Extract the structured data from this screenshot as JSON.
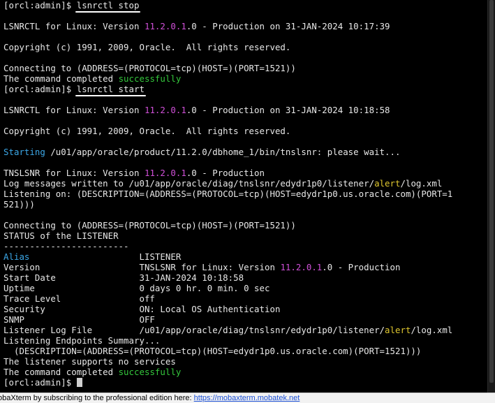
{
  "colors": {
    "text": "#e8e8e8",
    "version": "#d050d8",
    "success": "#34c83c",
    "cyan": "#3ca8e8",
    "alert": "#e0c830"
  },
  "terminal_lines": [
    [
      {
        "t": "[orcl:admin]$ "
      },
      {
        "t": "lsnrctl stop",
        "u": true
      }
    ],
    [],
    [
      {
        "t": "LSNRCTL for Linux: Version "
      },
      {
        "t": "11.2.0.1",
        "c": "version"
      },
      {
        "t": ".0 - Production on 31-JAN-2024 10:17:39"
      }
    ],
    [],
    [
      {
        "t": "Copyright (c) 1991, 2009, Oracle.  All rights reserved."
      }
    ],
    [],
    [
      {
        "t": "Connecting to (ADDRESS=(PROTOCOL=tcp)(HOST=)(PORT=1521))"
      }
    ],
    [
      {
        "t": "The command completed "
      },
      {
        "t": "successfully",
        "c": "success"
      }
    ],
    [
      {
        "t": "[orcl:admin]$ "
      },
      {
        "t": "lsnrctl start",
        "u": true
      }
    ],
    [],
    [
      {
        "t": "LSNRCTL for Linux: Version "
      },
      {
        "t": "11.2.0.1",
        "c": "version"
      },
      {
        "t": ".0 - Production on 31-JAN-2024 10:18:58"
      }
    ],
    [],
    [
      {
        "t": "Copyright (c) 1991, 2009, Oracle.  All rights reserved."
      }
    ],
    [],
    [
      {
        "t": "Starting",
        "c": "cyan"
      },
      {
        "t": " /u01/app/oracle/product/11.2.0/dbhome_1/bin/tnslsnr: please wait..."
      }
    ],
    [],
    [
      {
        "t": "TNSLSNR for Linux: Version "
      },
      {
        "t": "11.2.0.1",
        "c": "version"
      },
      {
        "t": ".0 - Production"
      }
    ],
    [
      {
        "t": "Log messages written to /u01/app/oracle/diag/tnslsnr/edydr1p0/listener/"
      },
      {
        "t": "alert",
        "c": "alert"
      },
      {
        "t": "/log.xml"
      }
    ],
    [
      {
        "t": "Listening on: (DESCRIPTION=(ADDRESS=(PROTOCOL=tcp)(HOST=edydr1p0.us.oracle.com)(PORT=1"
      }
    ],
    [
      {
        "t": "521)))"
      }
    ],
    [],
    [
      {
        "t": "Connecting to (ADDRESS=(PROTOCOL=tcp)(HOST=)(PORT=1521))"
      }
    ],
    [
      {
        "t": "STATUS of the LISTENER"
      }
    ],
    [
      {
        "t": "------------------------"
      }
    ],
    [
      {
        "t": "Alias",
        "c": "cyan"
      },
      {
        "t": "                     LISTENER"
      }
    ],
    [
      {
        "t": "Version                   TNSLSNR for Linux: Version "
      },
      {
        "t": "11.2.0.1",
        "c": "version"
      },
      {
        "t": ".0 - Production"
      }
    ],
    [
      {
        "t": "Start Date                31-JAN-2024 10:18:58"
      }
    ],
    [
      {
        "t": "Uptime                    0 days 0 hr. 0 min. 0 sec"
      }
    ],
    [
      {
        "t": "Trace Level               off"
      }
    ],
    [
      {
        "t": "Security                  ON: Local OS Authentication"
      }
    ],
    [
      {
        "t": "SNMP                      OFF"
      }
    ],
    [
      {
        "t": "Listener Log File         /u01/app/oracle/diag/tnslsnr/edydr1p0/listener/"
      },
      {
        "t": "alert",
        "c": "alert"
      },
      {
        "t": "/log.xml"
      }
    ],
    [
      {
        "t": "Listening Endpoints Summary..."
      }
    ],
    [
      {
        "t": "  (DESCRIPTION=(ADDRESS=(PROTOCOL=tcp)(HOST=edydr1p0.us.oracle.com)(PORT=1521)))"
      }
    ],
    [
      {
        "t": "The listener supports no services"
      }
    ],
    [
      {
        "t": "The command completed "
      },
      {
        "t": "successfully",
        "c": "success"
      }
    ],
    [
      {
        "t": "[orcl:admin]$ "
      },
      {
        "cursor": true
      }
    ]
  ],
  "statusbar": {
    "message": "obaXterm by subscribing to the professional edition here: ",
    "link": "https://mobaxterm.mobatek.net"
  }
}
